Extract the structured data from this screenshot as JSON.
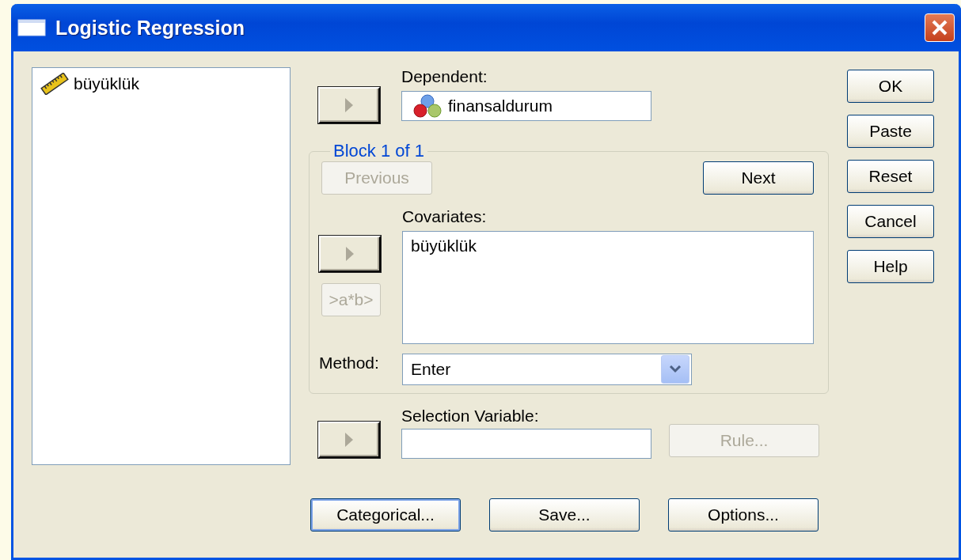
{
  "window": {
    "title": "Logistic Regression"
  },
  "variables": [
    {
      "name": "büyüklük",
      "kind": "scale"
    }
  ],
  "dependent": {
    "label": "Dependent:",
    "value": "finansaldurum",
    "kind": "nominal"
  },
  "block": {
    "legend": "Block 1 of 1",
    "previous": {
      "label": "Previous",
      "disabled": true
    },
    "next": {
      "label": "Next",
      "disabled": false
    }
  },
  "covariates": {
    "label": "Covariates:",
    "items": [
      "büyüklük"
    ],
    "interaction_button": {
      "label": ">a*b>",
      "disabled": true
    }
  },
  "method": {
    "label": "Method:",
    "value": "Enter"
  },
  "selection": {
    "label": "Selection Variable:",
    "rule": {
      "label": "Rule...",
      "disabled": true
    }
  },
  "bottom_buttons": [
    {
      "label": "Categorical...",
      "focused": true
    },
    {
      "label": "Save...",
      "focused": false
    },
    {
      "label": "Options...",
      "focused": false
    }
  ],
  "side_buttons": [
    {
      "label": "OK"
    },
    {
      "label": "Paste"
    },
    {
      "label": "Reset"
    },
    {
      "label": "Cancel"
    },
    {
      "label": "Help"
    }
  ]
}
